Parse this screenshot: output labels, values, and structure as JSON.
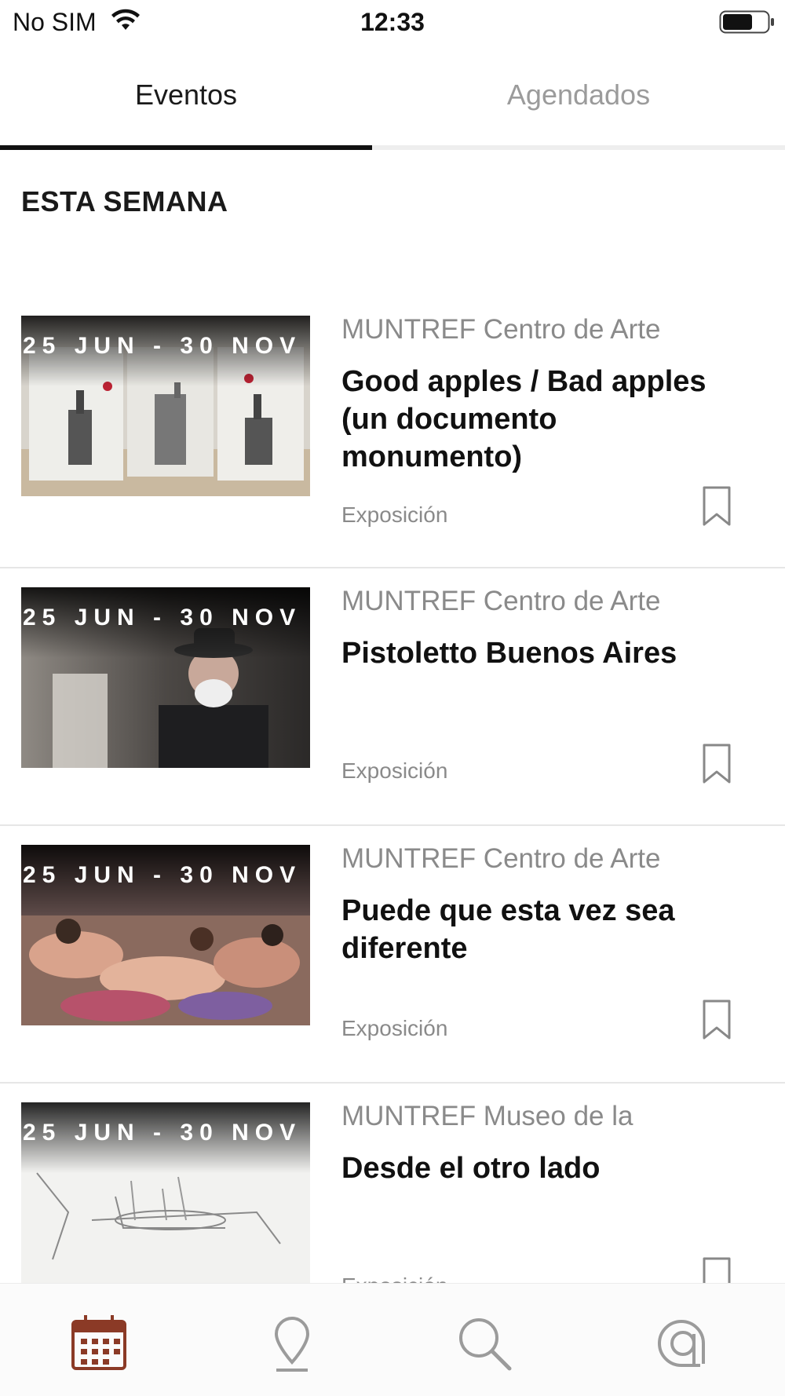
{
  "status_bar": {
    "carrier": "No SIM",
    "time": "12:33",
    "wifi_icon": "wifi-icon",
    "battery_icon": "battery-icon"
  },
  "tabs": [
    {
      "label": "Eventos",
      "active": true
    },
    {
      "label": "Agendados",
      "active": false
    }
  ],
  "section_title": "ESTA SEMANA",
  "events": [
    {
      "date": "25 JUN - 30 NOV",
      "venue": "MUNTREF Centro de Arte",
      "title": "Good apples / Bad apples (un documento monumento)",
      "category": "Exposición",
      "bookmark_icon": "bookmark-outline-icon"
    },
    {
      "date": "25 JUN - 30 NOV",
      "venue": "MUNTREF Centro de Arte",
      "title": "Pistoletto Buenos Aires",
      "category": "Exposición",
      "bookmark_icon": "bookmark-outline-icon"
    },
    {
      "date": "25 JUN - 30 NOV",
      "venue": "MUNTREF Centro de Arte",
      "title": "Puede que esta vez sea diferente",
      "category": "Exposición",
      "bookmark_icon": "bookmark-outline-icon"
    },
    {
      "date": "25 JUN - 30 NOV",
      "venue": "MUNTREF Museo de la",
      "title": "Desde el otro lado",
      "category": "Exposición",
      "bookmark_icon": "bookmark-outline-icon"
    }
  ],
  "bottom_nav": [
    {
      "icon": "calendar-icon",
      "active": true
    },
    {
      "icon": "map-pin-icon",
      "active": false
    },
    {
      "icon": "search-icon",
      "active": false
    },
    {
      "icon": "at-sign-icon",
      "active": false
    }
  ],
  "colors": {
    "accent": "#8b3a26",
    "inactive_icon": "#9b9b9b",
    "text_primary": "#111111",
    "text_secondary": "#8a8a8a"
  }
}
